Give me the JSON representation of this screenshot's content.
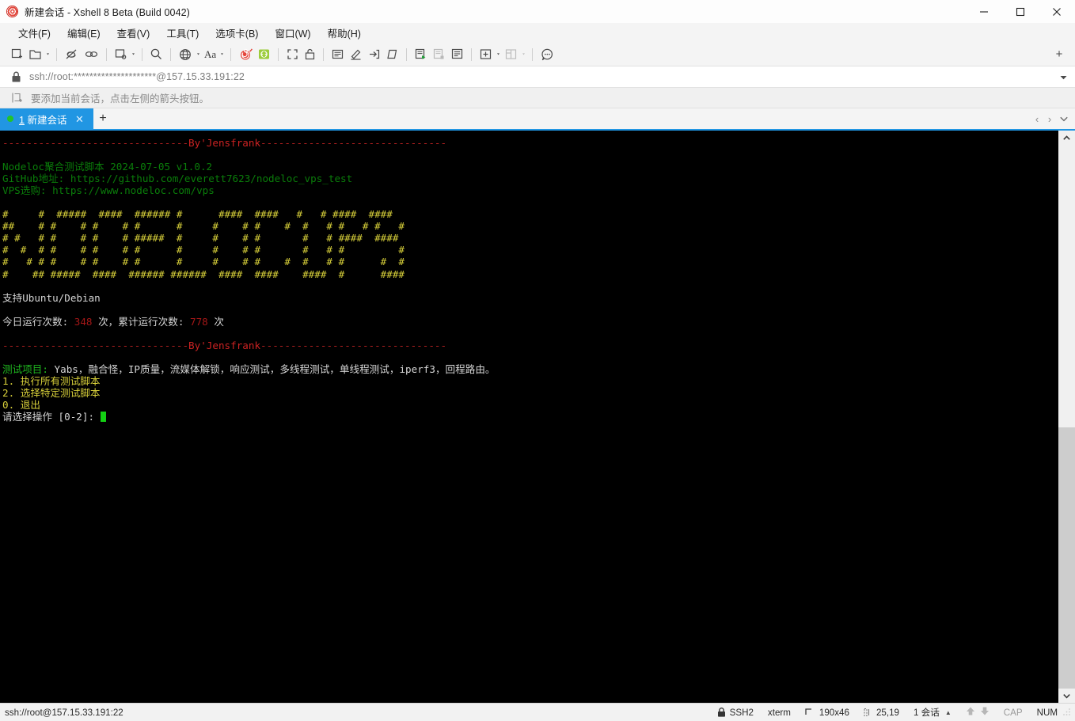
{
  "window": {
    "title": "新建会话 - Xshell 8 Beta (Build 0042)",
    "app_icon": "snail-icon",
    "minimize_label": "最小化",
    "maximize_label": "最大化",
    "close_label": "关闭"
  },
  "menubar": {
    "items": [
      {
        "label": "文件(F)",
        "name": "menu-file"
      },
      {
        "label": "编辑(E)",
        "name": "menu-edit"
      },
      {
        "label": "查看(V)",
        "name": "menu-view"
      },
      {
        "label": "工具(T)",
        "name": "menu-tools"
      },
      {
        "label": "选项卡(B)",
        "name": "menu-tabs"
      },
      {
        "label": "窗口(W)",
        "name": "menu-window"
      },
      {
        "label": "帮助(H)",
        "name": "menu-help"
      }
    ]
  },
  "toolbar": {
    "items": [
      "new-session-icon",
      "open-folder-icon",
      "separator",
      "disconnect-icon",
      "reconnect-icon",
      "separator",
      "session-properties-icon",
      "separator",
      "find-icon",
      "separator",
      "encoding-globe-icon",
      "font-size-icon",
      "separator",
      "xshell-snail-icon",
      "xftp-icon",
      "separator",
      "fullscreen-icon",
      "unlock-icon",
      "separator",
      "compose-pane-icon",
      "highlight-icon",
      "send-key-icon",
      "clear-screen-icon",
      "separator",
      "start-log-icon",
      "pause-log-icon",
      "open-log-icon",
      "separator",
      "add-tab-icon",
      "split-layout-icon",
      "separator",
      "chat-icon"
    ],
    "plus_label": "+"
  },
  "address": {
    "icon": "lock-icon",
    "value": "ssh://root:*********************@157.15.33.191:22",
    "placeholder": "ssh://",
    "dropdown_icon": "chevron-down-icon"
  },
  "hint": {
    "icon": "add-session-icon",
    "text": "要添加当前会话，点击左侧的箭头按钮。"
  },
  "tabs": {
    "active_index": 0,
    "items": [
      {
        "num": "1",
        "label": "新建会话",
        "status": "connected",
        "close_glyph": "✕"
      }
    ],
    "add_glyph": "+",
    "nav_prev_glyph": "‹",
    "nav_next_glyph": "›",
    "nav_list_glyph": "⌄"
  },
  "terminal": {
    "lines": [
      {
        "segments": [
          {
            "text": "-------------------------------",
            "class": "red"
          },
          {
            "text": "By'Jensfrank",
            "class": "brred"
          },
          {
            "text": "-------------------------------",
            "class": "red"
          }
        ]
      },
      {
        "segments": []
      },
      {
        "segments": [
          {
            "text": "Nodeloc聚合测试脚本 2024-07-05 v1.0.2",
            "class": "green"
          }
        ]
      },
      {
        "segments": [
          {
            "text": "GitHub地址: https://github.com/everett7623/nodeloc_vps_test",
            "class": "green"
          }
        ]
      },
      {
        "segments": [
          {
            "text": "VPS选购: https://www.nodeloc.com/vps",
            "class": "green"
          }
        ]
      },
      {
        "segments": []
      },
      {
        "segments": [
          {
            "text": "#     #  #####  ####  ###### #      ####  ####   #   # ####  ####",
            "class": "yellow"
          }
        ]
      },
      {
        "segments": [
          {
            "text": "##    # #    # #    # #      #     #    # #    #  #   # #   # #   #",
            "class": "yellow"
          }
        ]
      },
      {
        "segments": [
          {
            "text": "# #   # #    # #    # #####  #     #    # #       #   # ####  ####",
            "class": "yellow"
          }
        ]
      },
      {
        "segments": [
          {
            "text": "#  #  # #    # #    # #      #     #    # #       #   # #         #",
            "class": "yellow"
          }
        ]
      },
      {
        "segments": [
          {
            "text": "#   # # #    # #    # #      #     #    # #    #  #   # #      #  #",
            "class": "yellow"
          }
        ]
      },
      {
        "segments": [
          {
            "text": "#    ## #####  ####  ###### ######  ####  ####    ####  #      ####",
            "class": "yellow"
          }
        ]
      },
      {
        "segments": []
      },
      {
        "segments": [
          {
            "text": "支持Ubuntu/Debian",
            "class": "white"
          }
        ]
      },
      {
        "segments": []
      },
      {
        "segments": [
          {
            "text": "今日运行次数: ",
            "class": "white"
          },
          {
            "text": "348",
            "class": "dkred"
          },
          {
            "text": " 次，累计运行次数: ",
            "class": "white"
          },
          {
            "text": "778",
            "class": "dkred"
          },
          {
            "text": " 次",
            "class": "white"
          }
        ]
      },
      {
        "segments": []
      },
      {
        "segments": [
          {
            "text": "-------------------------------",
            "class": "red"
          },
          {
            "text": "By'Jensfrank",
            "class": "brred"
          },
          {
            "text": "-------------------------------",
            "class": "red"
          }
        ]
      },
      {
        "segments": []
      },
      {
        "segments": [
          {
            "text": "测试项目: ",
            "class": "ltgreen"
          },
          {
            "text": "Yabs，融合怪，IP质量，流媒体解锁，响应测试，多线程测试，单线程测试，iperf3，回程路由。",
            "class": "white"
          }
        ]
      },
      {
        "segments": [
          {
            "text": "1. 执行所有测试脚本",
            "class": "yellow"
          }
        ]
      },
      {
        "segments": [
          {
            "text": "2. 选择特定测试脚本",
            "class": "yellow"
          }
        ]
      },
      {
        "segments": [
          {
            "text": "0. 退出",
            "class": "yellow"
          }
        ]
      },
      {
        "segments": [
          {
            "text": "请选择操作 [0-2]: ",
            "class": "white"
          },
          {
            "text": "",
            "class": "cursor"
          }
        ]
      }
    ]
  },
  "scrollbar": {
    "up_glyph": "⌃",
    "down_glyph": "⌄",
    "thumb_top_pct": 52,
    "thumb_height_pct": 48
  },
  "statusbar": {
    "connection": "ssh://root@157.15.33.191:22",
    "protocol": "SSH2",
    "protocol_icon": "lock-icon",
    "terminal_type": "xterm",
    "size_icon": "screen-size-icon",
    "size": "190x46",
    "cursor_icon": "cursor-pos-icon",
    "cursor_pos": "25,19",
    "sessions": "1 会话",
    "sessions_caret": "▲",
    "transfer_up_icon": "arrow-up-icon",
    "transfer_down_icon": "arrow-down-icon",
    "caps": "CAP",
    "num": "NUM"
  }
}
